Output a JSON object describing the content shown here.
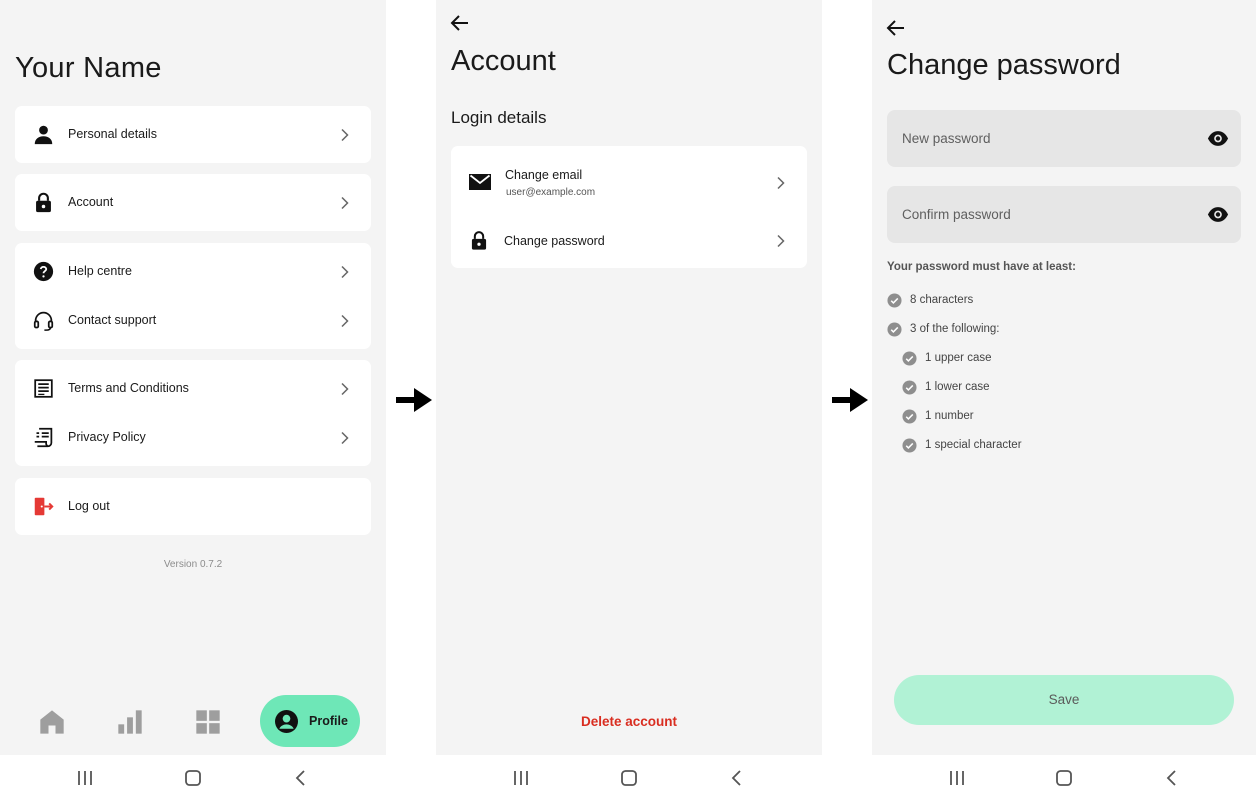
{
  "screen1": {
    "title": "Your Name",
    "cards": [
      {
        "items": [
          {
            "label": "Personal details",
            "icon": "person-icon"
          }
        ]
      },
      {
        "items": [
          {
            "label": "Account",
            "icon": "lock-icon"
          }
        ]
      },
      {
        "items": [
          {
            "label": "Help centre",
            "icon": "help-circle-icon"
          },
          {
            "label": "Contact support",
            "icon": "headset-icon"
          }
        ]
      },
      {
        "items": [
          {
            "label": "Terms and Conditions",
            "icon": "document-list-icon"
          },
          {
            "label": "Privacy Policy",
            "icon": "receipt-icon"
          }
        ]
      },
      {
        "items": [
          {
            "label": "Log out",
            "icon": "logout-icon"
          }
        ]
      }
    ],
    "version": "Version 0.7.2",
    "bottom_nav": {
      "items": [
        "home-icon",
        "bar-chart-icon",
        "grid-icon"
      ],
      "active_label": "Profile",
      "active_color": "#6ee7b7"
    }
  },
  "screen2": {
    "title": "Account",
    "section": "Login details",
    "change_email": {
      "label": "Change email",
      "value": "user@example.com"
    },
    "change_password": {
      "label": "Change password"
    },
    "delete_label": "Delete account",
    "delete_color": "#d92d20"
  },
  "screen3": {
    "title": "Change password",
    "new_password_placeholder": "New password",
    "confirm_password_placeholder": "Confirm password",
    "requirements_heading": "Your password must have at least:",
    "requirements": [
      {
        "text": "8 characters",
        "level": 0
      },
      {
        "text": "3 of the following:",
        "level": 0
      },
      {
        "text": "1 upper case",
        "level": 1
      },
      {
        "text": "1 lower case",
        "level": 1
      },
      {
        "text": "1 number",
        "level": 1
      },
      {
        "text": "1 special character",
        "level": 1
      }
    ],
    "save_label": "Save",
    "save_color": "#b1f2d5"
  }
}
